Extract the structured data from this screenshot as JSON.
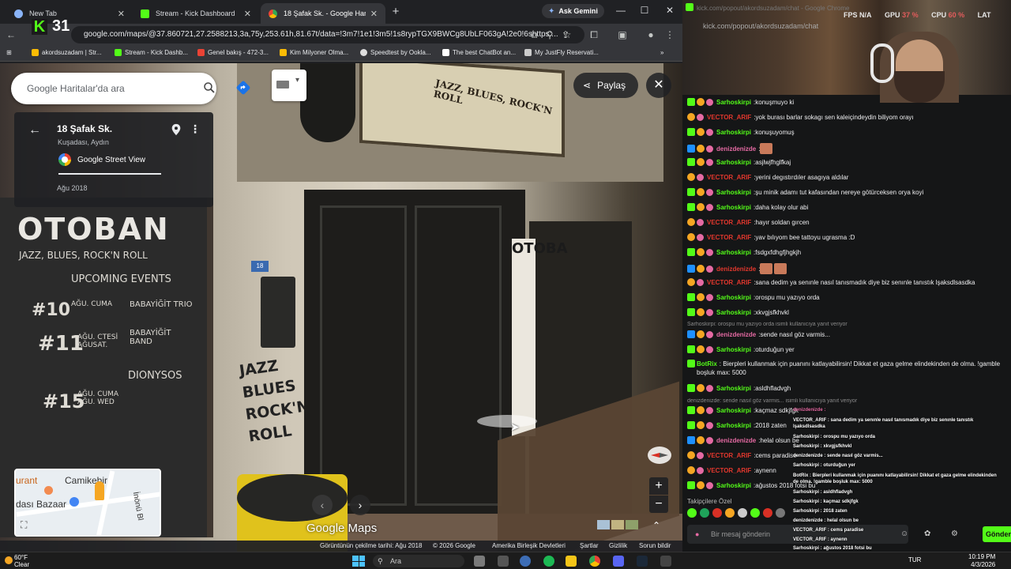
{
  "browser": {
    "tabs": [
      {
        "label": "New Tab",
        "icon": "chrome-icon"
      },
      {
        "label": "Stream - Kick Dashboard",
        "icon": "kick-icon"
      },
      {
        "label": "18 Şafak Sk. - Google Haritalar",
        "icon": "maps-icon"
      }
    ],
    "ask_gemini": "Ask Gemini",
    "url": "google.com/maps/@37.860721,27.2588213,3a,75y,253.61h,81.67t/data=!3m7!1e1!3m5!1s8rypTGX9BWCg8UbLF063gA!2e0!6shttps:...",
    "kick_overlay_count": "31",
    "bookmarks": [
      "akordsuzadam | Str...",
      "Stream - Kick Dashb...",
      "Genel bakış - 472-3...",
      "Kim Milyoner Olma...",
      "Speedtest by Ookla...",
      "The best ChatBot an...",
      "My JustFly Reservati..."
    ]
  },
  "maps": {
    "search_placeholder": "Google Haritalar'da ara",
    "place_title": "18 Şafak Sk.",
    "place_subtitle": "Kuşadası, Aydın",
    "street_view_label": "Google Street View",
    "capture_month": "Ağu 2018",
    "share_label": "Paylaş",
    "brand": "Google Maps",
    "minimap": {
      "label1": "Camikebir",
      "label2": "dası Bazaar",
      "label3": "urant",
      "label4": "İnönü Bl"
    },
    "footer": {
      "capture_date": "Görüntünün çekilme tarihi: Ağu 2018",
      "copyright": "© 2026 Google",
      "country": "Amerika Birleşik Devletleri",
      "terms": "Şartlar",
      "privacy": "Gizlilik",
      "report": "Sorun bildir"
    },
    "scene": {
      "house_number": "18",
      "top_sign": "JAZZ, BLUES, ROCK'N ROLL",
      "chalk_title": "OTOBAN",
      "chalk_sub": "JAZZ, BLUES, ROCK'N ROLL",
      "chalk_events": "UPCOMING EVENTS",
      "event1_num": "#10",
      "event1_date": "AĞU. CUMA",
      "event1_act": "BABAYİĞİT TRIO",
      "event2_num": "#11",
      "event2_date": "AĞU. CTESİ AĞUSAT.",
      "event2_act": "BABAYİĞİT BAND",
      "event3_num": "#15",
      "event3_date": "AĞU. CUMA AĞU. WED",
      "event3_act": "DIONYSOS",
      "wall_sign": "JAZZ BLUES ROCK'N ROLL",
      "vertical_sign": "OTOBA"
    }
  },
  "stream": {
    "stats": {
      "fps_label": "FPS",
      "fps": "N/A",
      "gpu_label": "GPU",
      "gpu": "37 %",
      "cpu_label": "CPU",
      "cpu": "60 %",
      "lat_label": "LAT"
    },
    "popout_url": "kick.com/popout/akordsuzadam/chat",
    "popout_url_faint": "kick.com/popout/akordsuzadam/chat - Google Chrome",
    "messages": [
      {
        "user": "Sarhoskirpi",
        "color": "green",
        "text": "konuşmuyo ki"
      },
      {
        "user": "VECTOR_ARIF",
        "color": "red",
        "text": "yok burası barlar sokagı sen kaleiçindeydin biliyom orayı"
      },
      {
        "user": "Sarhoskirpi",
        "color": "green",
        "text": "konuşuyomuş"
      },
      {
        "user": "denizdenizde",
        "color": "pink",
        "text": ""
      },
      {
        "user": "Sarhoskirpi",
        "color": "green",
        "text": "asjlwjfhglfkaj"
      },
      {
        "user": "VECTOR_ARIF",
        "color": "red",
        "text": "yerini degıstırdıler asagıya aldılar"
      },
      {
        "user": "Sarhoskirpi",
        "color": "green",
        "text": "şu minik adamı tut kafasından nereye götürceksen orya koyi"
      },
      {
        "user": "Sarhoskirpi",
        "color": "green",
        "text": "daha kolay olur abi"
      },
      {
        "user": "VECTOR_ARIF",
        "color": "red",
        "text": "hayır soldan gırcen"
      },
      {
        "user": "VECTOR_ARIF",
        "color": "red",
        "text": "yav bılıyom bee tattoyu ugrasma :D"
      },
      {
        "user": "Sarhoskirpi",
        "color": "green",
        "text": "fsdgxfdhgfjhgkjh"
      },
      {
        "user": "denizdenizde",
        "color": "pink",
        "text": ""
      },
      {
        "user": "VECTOR_ARIF",
        "color": "red",
        "text": "sana dedim ya senınle nasıl tanısmadık diye biz senınle tanıstık lşaksdlsasdka"
      },
      {
        "user": "Sarhoskirpi",
        "color": "green",
        "text": "orospu mu yazıyo orda"
      },
      {
        "user": "Sarhoskirpi",
        "color": "green",
        "text": "xkvgjsfkhvkl"
      },
      {
        "user": "denizdenizde",
        "color": "pink",
        "text": "sende nasıl göz varmis..."
      },
      {
        "user": "Sarhoskirpi",
        "color": "green",
        "text": "oturduğun yer"
      },
      {
        "user": "BotRix",
        "color": "green",
        "text": "Bierpleri kullanmak için puanını katlayabilirsin! Dikkat et gaza gelme elindekinden de olma. !gamble boşluk max: 5000"
      },
      {
        "user": "Sarhoskirpi",
        "color": "green",
        "text": "asldhfladvgh"
      },
      {
        "user": "Sarhoskirpi",
        "color": "green",
        "text": "kaçmaz sdkjfgk"
      },
      {
        "user": "Sarhoskirpi",
        "color": "green",
        "text": "2018 zaten"
      },
      {
        "user": "denizdenizde",
        "color": "pink",
        "text": "helal olsun be"
      },
      {
        "user": "VECTOR_ARIF",
        "color": "red",
        "text": "cems paradise"
      },
      {
        "user": "VECTOR_ARIF",
        "color": "red",
        "text": "aynenn"
      },
      {
        "user": "Sarhoskirpi",
        "color": "green",
        "text": "ağustos 2018 fotsi bu"
      }
    ],
    "reply_1": "Sarhoskirpi: orospu mu yazıyo orda isimli kullanıcıya yanıt veriyor",
    "reply_2": "denizdenizde: sende nasıl göz varmis... isimli kullanıcıya yanıt veriyor",
    "followers_only": "Takipçilere Özel",
    "chat_placeholder": "Bir mesaj gönderin",
    "send": "Gönder",
    "overlay_messages": [
      "denizdenizde :",
      "VECTOR_ARIF : sana dedim ya senınle nasıl tanısmadık diye biz senınle tanıstık lşaksdlsasdka",
      "Sarhoskirpi : orospu mu yazıyo orda",
      "Sarhoskirpi : xkvgjsfkhvkl",
      "denizdenizde : sende nasıl göz varmis...",
      "Sarhoskirpi : oturduğun yer",
      "BotRix : Bierpleri kullanmak için puanını katlayabilirsin! Dikkat et gaza gelme elindekinden de olma. !gamble boşluk max: 5000",
      "Sarhoskirpi : asldhfladvgh",
      "Sarhoskirpi : kaçmaz sdkjfgk",
      "Sarhoskirpi : 2018 zaten",
      "denizdenizde : helal olsun be",
      "VECTOR_ARIF : cems paradise",
      "VECTOR_ARIF : aynenn",
      "Sarhoskirpi : ağustos 2018 fotsi bu"
    ]
  },
  "taskbar": {
    "temp": "60°F",
    "weather": "Clear",
    "search": "Ara",
    "lang": "TUR",
    "time": "10:19 PM",
    "date": "4/3/2026"
  },
  "colors": {
    "kick_green": "#53fc18",
    "vector_red": "#e1372d",
    "deniz_pink": "#e56aa3"
  }
}
